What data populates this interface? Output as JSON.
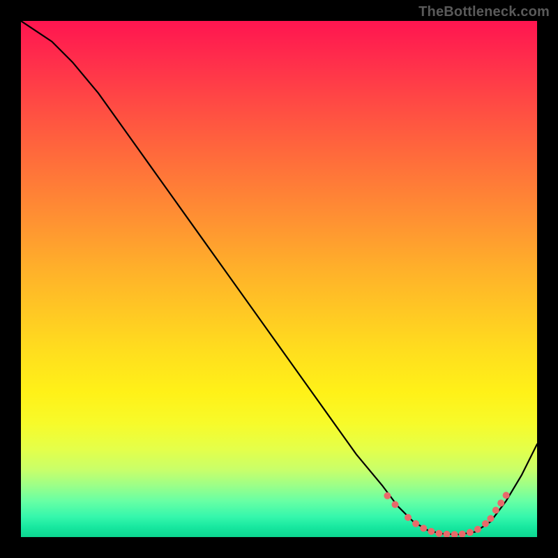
{
  "watermark": {
    "text": "TheBottleneck.com"
  },
  "chart_data": {
    "type": "line",
    "title": "",
    "xlabel": "",
    "ylabel": "",
    "xlim": [
      0,
      100
    ],
    "ylim": [
      0,
      100
    ],
    "grid": false,
    "legend": false,
    "annotations": [],
    "series": [
      {
        "name": "bottleneck-curve",
        "x": [
          0,
          3,
          6,
          10,
          15,
          20,
          25,
          30,
          35,
          40,
          45,
          50,
          55,
          60,
          65,
          70,
          73,
          76,
          79,
          82,
          85,
          88,
          91,
          94,
          97,
          100
        ],
        "y": [
          100,
          98,
          96,
          92,
          86,
          79,
          72,
          65,
          58,
          51,
          44,
          37,
          30,
          23,
          16,
          10,
          6,
          3,
          1.2,
          0.6,
          0.5,
          1.0,
          3,
          7,
          12,
          18
        ]
      }
    ],
    "markers": [
      {
        "name": "highlight-dots",
        "color": "#e86a6a",
        "points": [
          {
            "x": 71,
            "y": 8
          },
          {
            "x": 72.5,
            "y": 6.3
          },
          {
            "x": 75,
            "y": 3.8
          },
          {
            "x": 76.5,
            "y": 2.6
          },
          {
            "x": 78,
            "y": 1.7
          },
          {
            "x": 79.5,
            "y": 1.1
          },
          {
            "x": 81,
            "y": 0.7
          },
          {
            "x": 82.5,
            "y": 0.55
          },
          {
            "x": 84,
            "y": 0.5
          },
          {
            "x": 85.5,
            "y": 0.6
          },
          {
            "x": 87,
            "y": 0.9
          },
          {
            "x": 88.5,
            "y": 1.5
          },
          {
            "x": 90,
            "y": 2.6
          },
          {
            "x": 91,
            "y": 3.6
          },
          {
            "x": 92,
            "y": 5.2
          },
          {
            "x": 93,
            "y": 6.6
          },
          {
            "x": 94,
            "y": 8.1
          }
        ]
      }
    ],
    "background_gradient": {
      "orientation": "vertical",
      "stops": [
        {
          "pos": 0.0,
          "color": "#ff1550"
        },
        {
          "pos": 0.5,
          "color": "#ffc320"
        },
        {
          "pos": 0.8,
          "color": "#f2ff30"
        },
        {
          "pos": 1.0,
          "color": "#0cd790"
        }
      ]
    }
  }
}
